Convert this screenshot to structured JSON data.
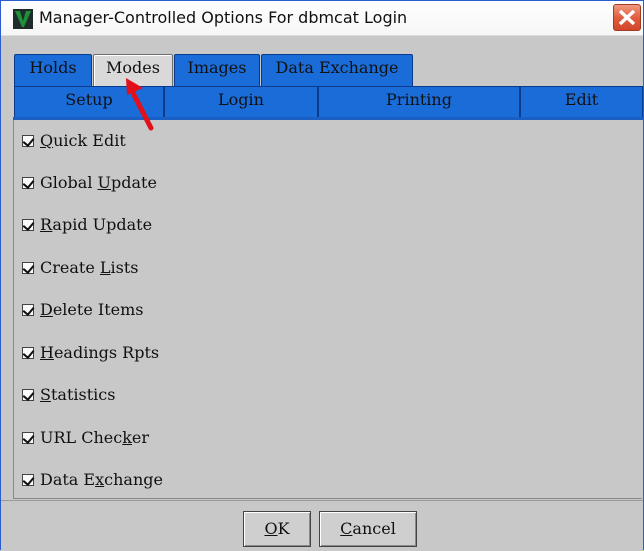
{
  "window": {
    "title": "Manager-Controlled Options For dbmcat Login",
    "close_icon": "close-x-icon",
    "app_icon": "app-v-logo-icon"
  },
  "tabs_row1": [
    {
      "label": "Holds",
      "active": false
    },
    {
      "label": "Modes",
      "active": true
    },
    {
      "label": "Images",
      "active": false
    },
    {
      "label": "Data Exchange",
      "active": false
    }
  ],
  "tabs_row2": [
    {
      "label": "Setup"
    },
    {
      "label": "Login"
    },
    {
      "label": "Printing"
    },
    {
      "label": "Edit"
    }
  ],
  "options": [
    {
      "pre": "",
      "u": "Q",
      "post": "uick Edit",
      "checked": true
    },
    {
      "pre": "Global ",
      "u": "U",
      "post": "pdate",
      "checked": true
    },
    {
      "pre": "",
      "u": "R",
      "post": "apid Update",
      "checked": true
    },
    {
      "pre": "Create ",
      "u": "L",
      "post": "ists",
      "checked": true
    },
    {
      "pre": "",
      "u": "D",
      "post": "elete Items",
      "checked": true
    },
    {
      "pre": "",
      "u": "H",
      "post": "eadings Rpts",
      "checked": true
    },
    {
      "pre": "",
      "u": "S",
      "post": "tatistics",
      "checked": true
    },
    {
      "pre": "URL Chec",
      "u": "k",
      "post": "er",
      "checked": true
    },
    {
      "pre": "Data E",
      "u": "x",
      "post": "change",
      "checked": true
    }
  ],
  "buttons": {
    "ok": {
      "u": "O",
      "post": "K"
    },
    "cancel": {
      "u": "C",
      "post": "ancel"
    }
  },
  "colors": {
    "tab_blue": "#1a6cd8",
    "annotation_arrow": "#e2101b"
  }
}
